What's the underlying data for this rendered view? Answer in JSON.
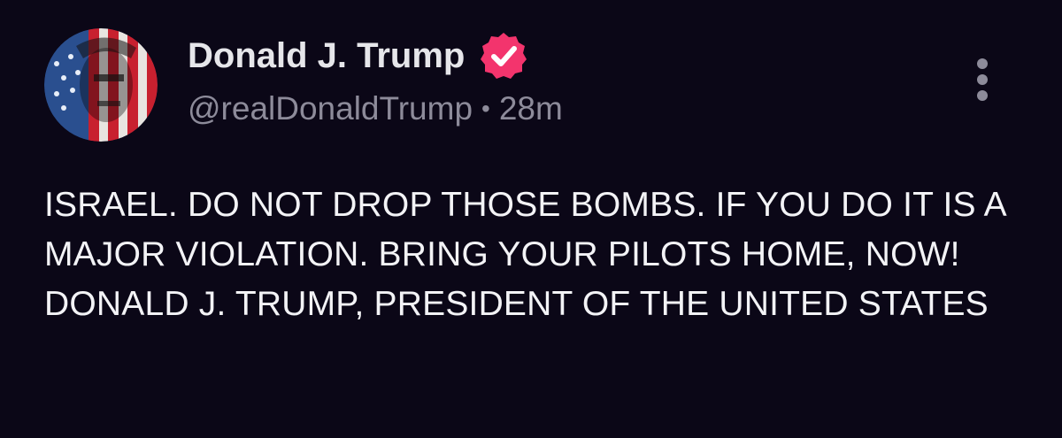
{
  "author": {
    "display_name": "Donald J. Trump",
    "handle": "@realDonaldTrump",
    "separator": "•",
    "time_ago": "28m",
    "avatar": "avatar-flag-portrait",
    "verified_icon": "verified-badge-icon"
  },
  "post": {
    "text": "ISRAEL. DO NOT DROP THOSE BOMBS. IF YOU DO IT IS A MAJOR VIOLATION. BRING YOUR PILOTS HOME, NOW! DONALD J. TRUMP, PRESIDENT OF THE UNITED STATES"
  },
  "actions": {
    "more_icon": "more-vertical-icon"
  },
  "colors": {
    "background": "#0b0717",
    "name": "#e6e6ea",
    "handle": "#8d8b9a",
    "body_text": "#f3f3f6",
    "verified": "#f3346d"
  }
}
